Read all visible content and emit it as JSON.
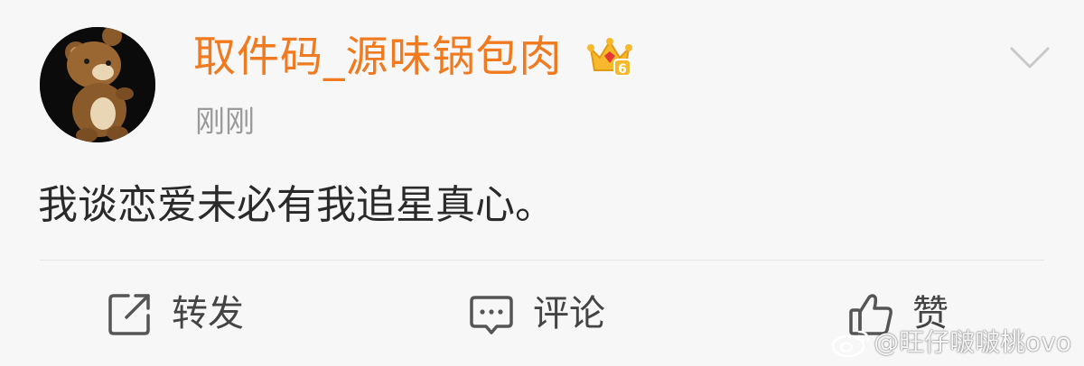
{
  "post": {
    "username": "取件码_源味锅包肉",
    "timestamp": "刚刚",
    "text": "我谈恋爱未必有我追星真心。",
    "vip_level": "6",
    "username_color": "#f07a1f"
  },
  "icons": {
    "avatar": "bear-avatar-icon",
    "vip": "crown-vip-icon",
    "more": "chevron-down-icon",
    "repost": "share-icon",
    "comment": "comment-icon",
    "like": "thumbs-up-icon",
    "watermark": "weibo-logo-icon"
  },
  "actions": {
    "repost_label": "转发",
    "comment_label": "评论",
    "like_label": "赞"
  },
  "watermark": {
    "text": "@旺仔啵啵桃ovo"
  }
}
